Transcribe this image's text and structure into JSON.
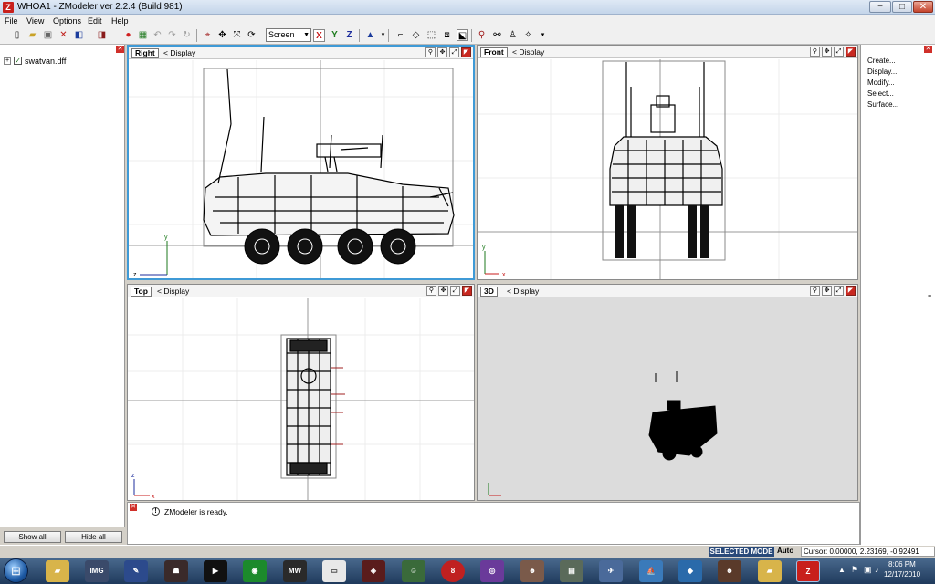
{
  "window": {
    "title": "WHOA1 - ZModeler ver 2.2.4 (Build 981)",
    "app_icon_letter": "Z",
    "minimize_glyph": "−",
    "maximize_glyph": "□",
    "close_glyph": "✕"
  },
  "menu": [
    "File",
    "View",
    "Options",
    "Edit",
    "Help"
  ],
  "toolbar": {
    "mode_select": "Screen",
    "axis_x": "X",
    "axis_y": "Y",
    "axis_z": "Z"
  },
  "scene_tree": {
    "expand_glyph": "+",
    "check_glyph": "✓",
    "file": "swatvan.dff",
    "show_all_label": "Show all",
    "hide_all_label": "Hide all"
  },
  "viewports": [
    {
      "label": "Right",
      "display": "<  Display",
      "axis_h": "z",
      "axis_v": "y"
    },
    {
      "label": "Front",
      "display": "<  Display",
      "axis_h": "x",
      "axis_v": "y"
    },
    {
      "label": "Top",
      "display": "<  Display",
      "axis_h": "x",
      "axis_v": "z"
    },
    {
      "label": "3D",
      "display": "<  Display",
      "axis_h": "",
      "axis_v": ""
    }
  ],
  "command_panel": [
    "Create...",
    "Display...",
    "Modify...",
    "Select...",
    "Surface..."
  ],
  "log": {
    "icon_glyph": "!",
    "message": "ZModeler is ready."
  },
  "status": {
    "mode": "SELECTED MODE",
    "auto": "Auto",
    "cursor": "Cursor: 0.00000, 2.23169, -0.92491"
  },
  "taskbar": {
    "apps": [
      "Explorer",
      "IMG Tool",
      "Notes",
      "Game",
      "Media",
      "Nvidia",
      "NFS MW",
      "Paint",
      "Emulator",
      "Aliens",
      "Pool",
      "Retro",
      "Photo",
      "Installer",
      "Flight",
      "Boat",
      "Network",
      "Profile",
      "Folder",
      "ZModeler"
    ],
    "clock_time": "8:06 PM",
    "clock_date": "12/17/2010"
  },
  "colors": {
    "viewport_selected_border": "#3f9ad6",
    "status_mode_bg": "#2a4a7a",
    "close_red": "#c4432b"
  }
}
